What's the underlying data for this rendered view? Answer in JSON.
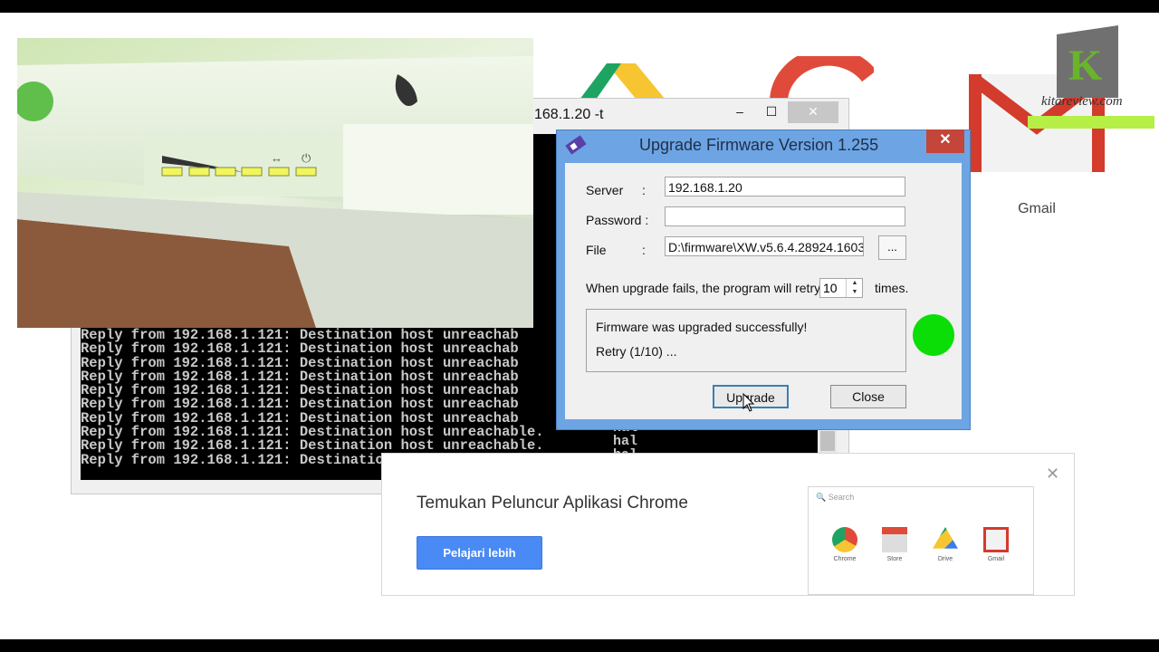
{
  "console": {
    "title": "168.1.20 -t",
    "minimize": "–",
    "maximize": "☐",
    "close": "✕",
    "right_fragments": [
      "hal",
      "hal",
      "hal",
      "hal",
      "hal",
      "hal",
      "hal"
    ],
    "lines": [
      "Reply from 192.168.1.121: Destination host unreachab",
      "Reply from 192.168.1.121: Destination host unreachab",
      "Reply from 192.168.1.121: Destination host unreachab",
      "Reply from 192.168.1.121: Destination host unreachab",
      "Reply from 192.168.1.121: Destination host unreachab",
      "Reply from 192.168.1.121: Destination host unreachab",
      "Reply from 192.168.1.121: Destination host unreachab",
      "Reply from 192.168.1.121: Destination host unreachable.",
      "Reply from 192.168.1.121: Destination host unreachable.",
      "Reply from 192.168.1.121: Destination host unreachable."
    ]
  },
  "dialog": {
    "title": "Upgrade Firmware Version 1.255",
    "close": "✕",
    "server_label": "Server",
    "server_colon": ":",
    "server_value": "192.168.1.20",
    "password_label": "Password :",
    "password_value": "",
    "file_label": "File",
    "file_colon": ":",
    "file_value": "D:\\firmware\\XW.v5.6.4.28924.1603",
    "browse_label": "...",
    "retry_prefix": "When upgrade fails, the program will retry",
    "retry_value": "10",
    "retry_suffix": "times.",
    "status_line1": "Firmware was upgraded successfully!",
    "status_line2": "Retry (1/10) ...",
    "upgrade_button": "Upgrade",
    "close_button": "Close",
    "status_color": "#0bde06"
  },
  "background": {
    "gmail_label": "Gmail",
    "watermark": "kitareview.com"
  },
  "chrome_promo": {
    "heading": "Temukan Peluncur Aplikasi Chrome",
    "button": "Pelajari lebih",
    "close": "✕",
    "search_placeholder": "Search",
    "apps": [
      "Chrome",
      "Store",
      "Drive",
      "Gmail"
    ]
  }
}
